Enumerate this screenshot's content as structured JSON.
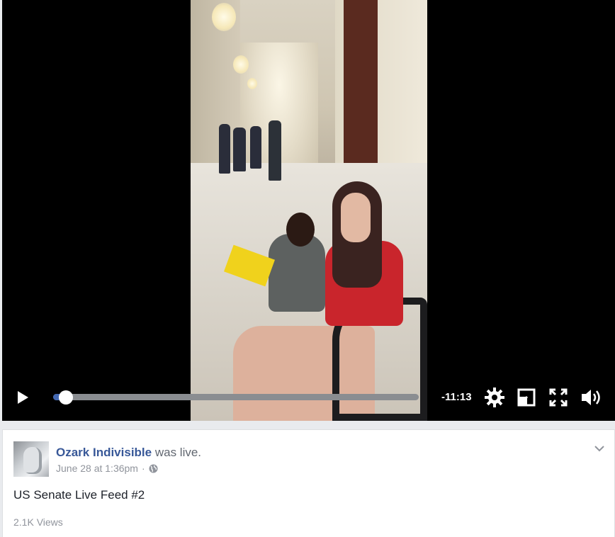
{
  "video": {
    "remaining_time": "-11:13",
    "progress": 0.02,
    "controls": {
      "play": "play-icon",
      "settings": "gear-icon",
      "dock": "dock-icon",
      "fullscreen": "fullscreen-icon",
      "volume": "volume-icon"
    }
  },
  "post": {
    "author": "Ozark Indivisible",
    "action": "was live.",
    "timestamp": "June 28 at 1:36pm",
    "separator": "·",
    "privacy_icon": "globe-icon",
    "title": "US Senate Live Feed #2",
    "views": "2.1K Views"
  },
  "colors": {
    "accent": "#4267b2",
    "author_link": "#385898",
    "meta_text": "#90949c"
  }
}
